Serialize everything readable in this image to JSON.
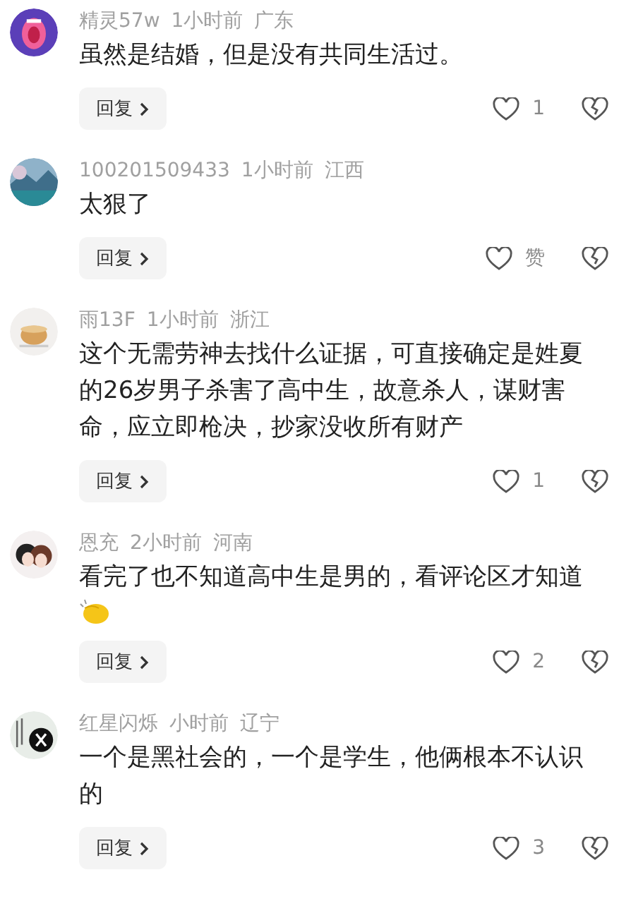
{
  "comments": [
    {
      "user": "精灵57w",
      "time": "1小时前",
      "region": "广东",
      "text": "虽然是结婚，但是没有共同生活过。",
      "emoji": false,
      "reply": "回复",
      "likes": "1"
    },
    {
      "user": "100201509433",
      "time": "1小时前",
      "region": "江西",
      "text": "太狠了",
      "emoji": false,
      "reply": "回复",
      "likes": "赞"
    },
    {
      "user": "雨13F",
      "time": "1小时前",
      "region": "浙江",
      "text": "这个无需劳神去找什么证据，可直接确定是姓夏的26岁男子杀害了高中生，故意杀人，谋财害命，应立即枪决，抄家没收所有财产",
      "emoji": false,
      "reply": "回复",
      "likes": "1"
    },
    {
      "user": "恩充",
      "time": "2小时前",
      "region": "河南",
      "text": "看完了也不知道高中生是男的，看评论区才知道",
      "emoji": true,
      "reply": "回复",
      "likes": "2"
    },
    {
      "user": "红星闪烁",
      "time": "小时前",
      "region": "辽宁",
      "text": "一个是黑社会的，一个是学生，他俩根本不认识的",
      "emoji": false,
      "reply": "回复",
      "likes": "3"
    }
  ]
}
